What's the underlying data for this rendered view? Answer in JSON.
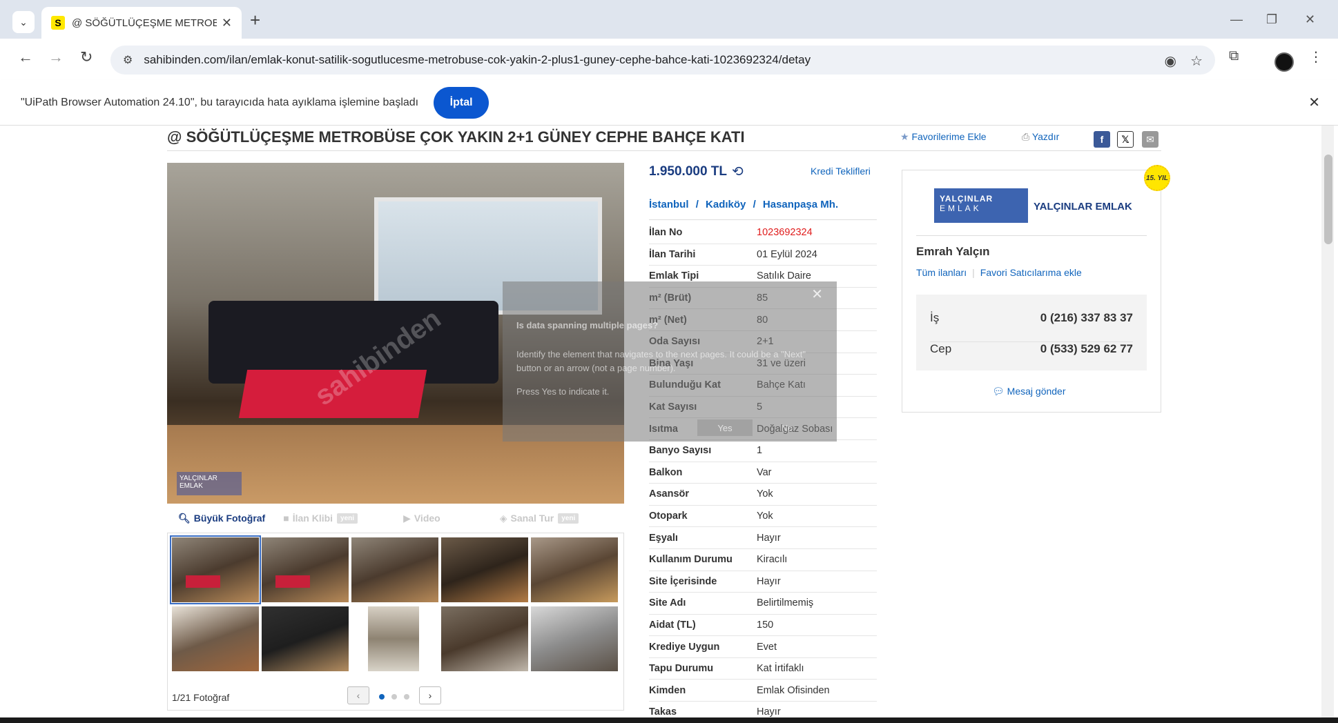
{
  "browser": {
    "tab_title": "@ SÖĞÜTLÜÇEŞME METROBÜS",
    "url": "sahibinden.com/ilan/emlak-konut-satilik-sogutlucesme-metrobuse-cok-yakin-2-plus1-guney-cephe-bahce-kati-1023692324/detay",
    "favicon_letter": "S"
  },
  "infobar": {
    "message": "\"UiPath Browser Automation 24.10\", bu tarayıcıda hata ayıklama işlemine başladı",
    "cancel_label": "İptal"
  },
  "listing": {
    "title": "@ SÖĞÜTLÜÇEŞME METROBÜSE ÇOK YAKIN 2+1 GÜNEY CEPHE BAHÇE KATI",
    "favorite_label": "Favorilerime Ekle",
    "print_label": "Yazdır",
    "price": "1.950.000 TL",
    "credit_offers": "Kredi Teklifleri",
    "location": [
      "İstanbul",
      "Kadıköy",
      "Hasanpaşa Mh."
    ],
    "location_sep": "/",
    "details": [
      {
        "label": "İlan No",
        "value": "1023692324"
      },
      {
        "label": "İlan Tarihi",
        "value": "01 Eylül 2024"
      },
      {
        "label": "Emlak Tipi",
        "value": "Satılık Daire"
      },
      {
        "label": "m² (Brüt)",
        "value": "85"
      },
      {
        "label": "m² (Net)",
        "value": "80"
      },
      {
        "label": "Oda Sayısı",
        "value": "2+1"
      },
      {
        "label": "Bina Yaşı",
        "value": "31 ve üzeri"
      },
      {
        "label": "Bulunduğu Kat",
        "value": "Bahçe Katı"
      },
      {
        "label": "Kat Sayısı",
        "value": "5"
      },
      {
        "label": "Isıtma",
        "value": "Doğalgaz Sobası"
      },
      {
        "label": "Banyo Sayısı",
        "value": "1"
      },
      {
        "label": "Balkon",
        "value": "Var"
      },
      {
        "label": "Asansör",
        "value": "Yok"
      },
      {
        "label": "Otopark",
        "value": "Yok"
      },
      {
        "label": "Eşyalı",
        "value": "Hayır"
      },
      {
        "label": "Kullanım Durumu",
        "value": "Kiracılı"
      },
      {
        "label": "Site İçerisinde",
        "value": "Hayır"
      },
      {
        "label": "Site Adı",
        "value": "Belirtilmemiş"
      },
      {
        "label": "Aidat (TL)",
        "value": "150"
      },
      {
        "label": "Krediye Uygun",
        "value": "Evet"
      },
      {
        "label": "Tapu Durumu",
        "value": "Kat İrtifaklı"
      },
      {
        "label": "Kimden",
        "value": "Emlak Ofisinden"
      },
      {
        "label": "Takas",
        "value": "Hayır"
      }
    ]
  },
  "media": {
    "large_photo": "Büyük Fotoğraf",
    "video_tour": "İlan Klibi",
    "video": "Video",
    "virtual_tour": "Sanal Tur",
    "new_badge": "yeni",
    "photo_count": "1/21 Fotoğraf",
    "photo_logo_text": "YALÇINLAR EMLAK",
    "watermark": "sahibinden"
  },
  "seller": {
    "company_logo_line1": "YALÇINLAR",
    "company_logo_line2": "EMLAK",
    "company": "YALÇINLAR EMLAK",
    "badge": "15. YIL",
    "name": "Emrah Yalçın",
    "all_listings": "Tüm ilanları",
    "add_favorite_seller": "Favori Satıcılarıma ekle",
    "phones": [
      {
        "label": "İş",
        "number": "0 (216) 337 83 37"
      },
      {
        "label": "Cep",
        "number": "0 (533) 529 62 77"
      }
    ],
    "message": "Mesaj gönder"
  },
  "overlay": {
    "question": "Is data spanning multiple pages?",
    "description": "Identify the element that navigates to the next pages. It could be a \"Next\" button or an arrow (not a page number).",
    "hint": "Press Yes to indicate it.",
    "yes": "Yes",
    "no": "No"
  },
  "colors": {
    "brand_blue": "#1a3c80",
    "link_blue": "#1064bc",
    "listing_no_red": "#e01c1c",
    "cancel_button": "#0b57d0",
    "badge_yellow": "#ffe600"
  }
}
